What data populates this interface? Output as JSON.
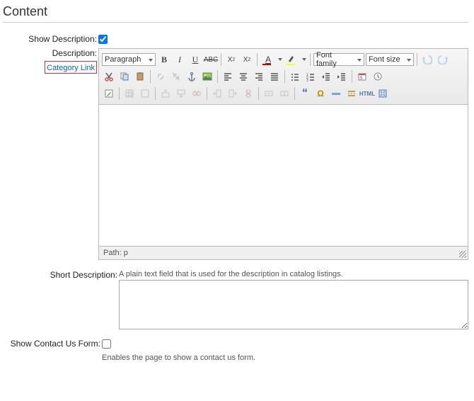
{
  "section": {
    "title": "Content"
  },
  "showDesc": {
    "label": "Show Description:",
    "checked": true
  },
  "desc": {
    "label": "Description:",
    "categoryLink": "Category Link",
    "format": "Paragraph",
    "fontFamily": "Font family",
    "fontSize": "Font size",
    "path": "Path: p"
  },
  "shortDesc": {
    "label": "Short Description:",
    "helper": "A plain text field that is used for the description in catalog listings.",
    "value": ""
  },
  "contact": {
    "label": "Show Contact Us Form:",
    "checked": false,
    "helper": "Enables the page to show a contact us form."
  }
}
